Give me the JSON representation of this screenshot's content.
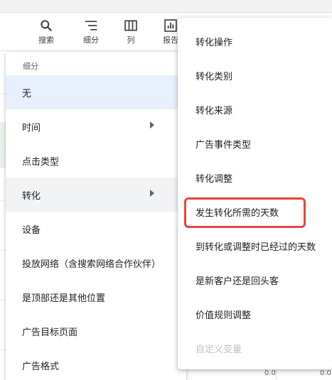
{
  "toolbar": {
    "items": [
      {
        "label": "搜索",
        "icon": "search-icon"
      },
      {
        "label": "细分",
        "icon": "segment-icon"
      },
      {
        "label": "列",
        "icon": "columns-icon"
      },
      {
        "label": "报告",
        "icon": "reports-icon"
      }
    ]
  },
  "menu": {
    "header": "细分",
    "items": [
      {
        "label": "无"
      },
      {
        "label": "时间"
      },
      {
        "label": "点击类型"
      },
      {
        "label": "转化"
      },
      {
        "label": "设备"
      },
      {
        "label": "投放网络（含搜索网络合作伙伴）"
      },
      {
        "label": "是顶部还是其他位置"
      },
      {
        "label": "广告目标页面"
      },
      {
        "label": "广告格式"
      }
    ]
  },
  "submenu": {
    "items": [
      {
        "label": "转化操作"
      },
      {
        "label": "转化类别"
      },
      {
        "label": "转化来源"
      },
      {
        "label": "广告事件类型"
      },
      {
        "label": "转化调整"
      },
      {
        "label": "发生转化所需的天数"
      },
      {
        "label": "到转化或调整时已经过的天数"
      },
      {
        "label": "是新客户还是回头客"
      },
      {
        "label": "价值规则调整"
      },
      {
        "label": "自定义变量"
      }
    ]
  },
  "background": {
    "values": [
      "0.0",
      "0.0"
    ]
  },
  "colors": {
    "selected_bg": "#e8f0fe",
    "hover_bg": "#f1f3f4",
    "highlight": "#e8453c",
    "disabled_text": "#bdc1c6"
  }
}
